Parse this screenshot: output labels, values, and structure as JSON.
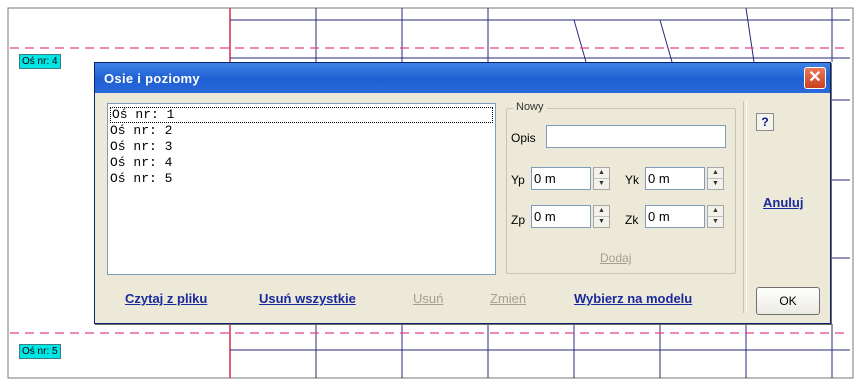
{
  "canvas": {
    "axis_labels": [
      "Oś nr: 4",
      "Oś nr: 5"
    ]
  },
  "dialog": {
    "title": "Osie i poziomy",
    "close_symbol": "✕",
    "list": {
      "items": [
        "Oś nr: 1",
        "Oś nr: 2",
        "Oś nr: 3",
        "Oś nr: 4",
        "Oś nr: 5"
      ],
      "selected_index": 0
    },
    "group": {
      "legend": "Nowy",
      "opis_label": "Opis",
      "opis_value": "",
      "yp_label": "Yp",
      "yp_value": "0 m",
      "yk_label": "Yk",
      "yk_value": "0 m",
      "zp_label": "Zp",
      "zp_value": "0 m",
      "zk_label": "Zk",
      "zk_value": "0 m",
      "add_label": "Dodaj"
    },
    "help_label": "?",
    "cancel_label": "Anuluj",
    "ok_label": "OK",
    "bottom_links": {
      "read_file": "Czytaj z pliku",
      "delete_all": "Usuń wszystkie",
      "delete": "Usuń",
      "modify": "Zmień",
      "select_on_model": "Wybierz na modelu"
    },
    "colors": {
      "title_bar": "#1d5ed1",
      "link": "#1a2a9c",
      "disabled": "#a3a092",
      "axis_tag": "#00e5e5",
      "dashed_axis": "#e04090"
    }
  }
}
